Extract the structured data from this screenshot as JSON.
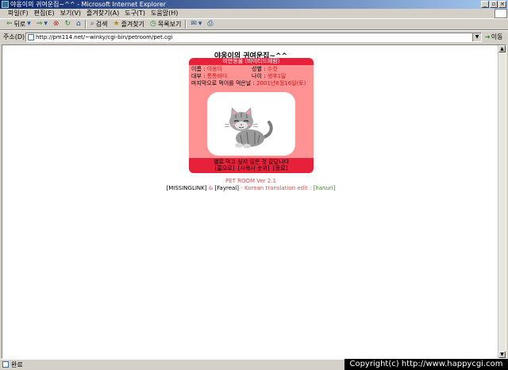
{
  "window": {
    "title": "야옹이의 귀여운집~^^ - Microsoft Internet Explorer"
  },
  "menu": {
    "items": [
      "파일(F)",
      "편집(E)",
      "보기(V)",
      "즐겨찾기(A)",
      "도구(T)",
      "도움말(H)"
    ]
  },
  "toolbar": {
    "back": "뒤로",
    "search": "검색",
    "favorites": "즐겨찾기",
    "history": "목록보기"
  },
  "address": {
    "label": "주소(D)",
    "url": "http://pm114.net/~winky/cgi-bin/petroom/pet.cgi",
    "go": "이동"
  },
  "page": {
    "title": "야옹이의 귀여운집~^^"
  },
  "pet": {
    "header": "비만동물 (비이티드돼람)",
    "name_label": "이름 :",
    "name_value": "야옹이",
    "gender_label": "성별 :",
    "gender_value": "수컷",
    "type_label": "대부 :",
    "type_value": "통통바다",
    "age_label": "나이 :",
    "age_value": "생후1달",
    "lastfed_label": "마지막으로 먹이를 먹은날 :",
    "lastfed_value": "2001년6월16일(토)",
    "message": "별로 먹고 싶지 않은 것 같답니다",
    "link_home": "[홈으로]",
    "link_ranking": "[사육사 순위]",
    "link_exit": "[종료]"
  },
  "credits": {
    "version": "PET ROOM Ver 2.1",
    "author1": "[MISSINGLINK]",
    "amp": "&",
    "author2": "[Fayreal]",
    "translation": "- Korean translation edit :",
    "translator": "[hanuri]"
  },
  "status": {
    "text": "완료"
  },
  "watermark": "Copyright(c) http://www.happycgi.com",
  "colors": {
    "pet_header": "#e8213b",
    "pet_bg": "#ff9393",
    "titlebar": "#0a246a"
  }
}
